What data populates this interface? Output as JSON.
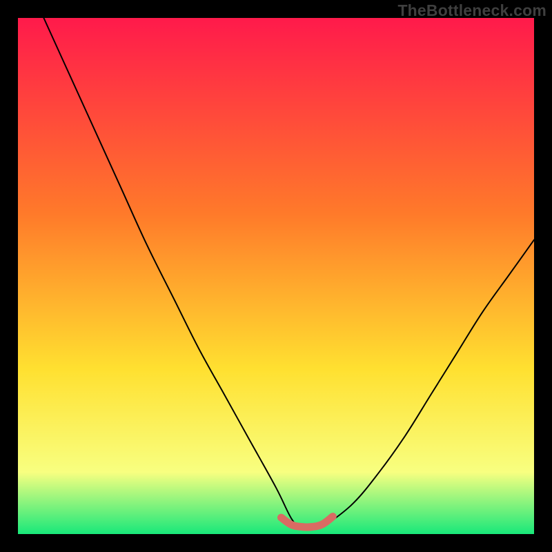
{
  "watermark": "TheBottleneck.com",
  "colors": {
    "frame": "#000000",
    "gradient_top": "#ff1a4b",
    "gradient_mid1": "#ff7a2a",
    "gradient_mid2": "#ffe030",
    "gradient_band": "#f8ff80",
    "gradient_bottom": "#18e87a",
    "curve": "#000000",
    "highlight": "#d96b63"
  },
  "chart_data": {
    "type": "line",
    "title": "",
    "xlabel": "",
    "ylabel": "",
    "xlim": [
      0,
      100
    ],
    "ylim": [
      0,
      100
    ],
    "series": [
      {
        "name": "bottleneck-curve",
        "x": [
          5,
          10,
          15,
          20,
          25,
          30,
          35,
          40,
          45,
          50,
          53,
          55,
          58,
          60,
          65,
          70,
          75,
          80,
          85,
          90,
          95,
          100
        ],
        "y": [
          100,
          89,
          78,
          67,
          56,
          46,
          36,
          27,
          18,
          9,
          3,
          1,
          1,
          2,
          6,
          12,
          19,
          27,
          35,
          43,
          50,
          57
        ]
      },
      {
        "name": "optimal-range-highlight",
        "x": [
          51,
          53,
          55,
          57,
          59,
          61
        ],
        "y": [
          3.2,
          1.8,
          1.4,
          1.4,
          1.9,
          3.4
        ]
      }
    ],
    "annotations": []
  }
}
